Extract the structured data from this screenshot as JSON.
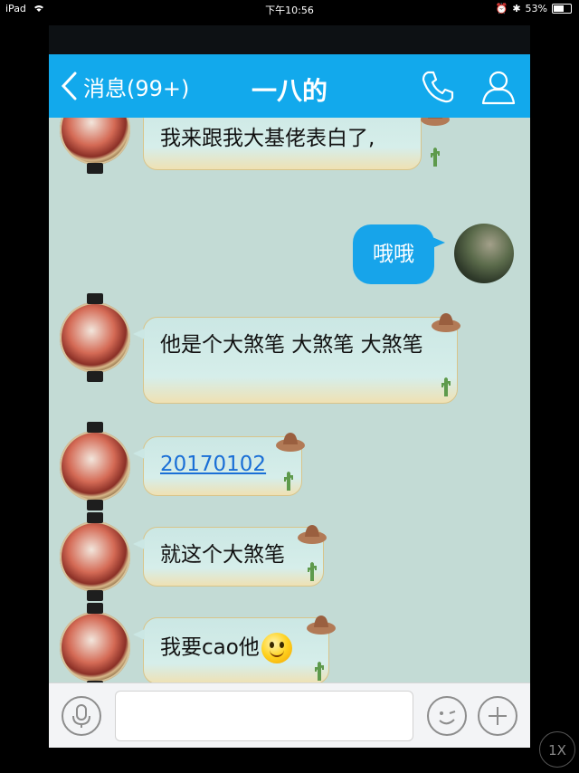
{
  "status_bar": {
    "device": "iPad",
    "time": "下午10:56",
    "battery": "53%",
    "battery_level": 0.53
  },
  "header": {
    "back_label": "消息(99+)",
    "title": "一八的",
    "call_icon": "phone-icon",
    "profile_icon": "contact-icon"
  },
  "messages": [
    {
      "side": "in",
      "text": "我来跟我大基佬表白了,"
    },
    {
      "side": "out",
      "text": "哦哦"
    },
    {
      "side": "in",
      "text": "他是个大煞笔 大煞笔 大煞笔"
    },
    {
      "side": "in",
      "text": "20170102",
      "is_link": true
    },
    {
      "side": "in",
      "text": "就这个大煞笔"
    },
    {
      "side": "in",
      "text": "我要cao他",
      "emoji": "smile-emoji"
    }
  ],
  "input_bar": {
    "text_value": "",
    "voice_icon": "microphone-icon",
    "emoji_icon": "emoji-face-icon",
    "more_icon": "plus-icon"
  },
  "zoom_button": "1X",
  "colors": {
    "nav_blue": "#12a9ec",
    "out_bubble": "#17a4ea",
    "chat_bg": "#c3dbd5",
    "link": "#1a6fd6"
  }
}
